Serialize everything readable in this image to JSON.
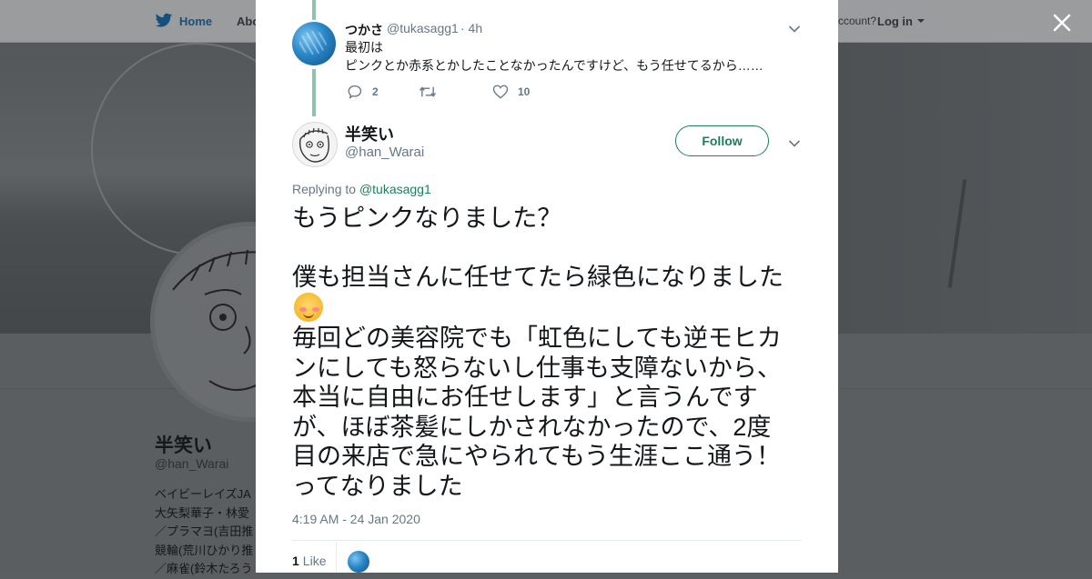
{
  "background": {
    "nav": {
      "home": "Home",
      "about": "Abo",
      "account_prompt": "ccount?",
      "login": "Log in"
    },
    "profile": {
      "name": "半笑い",
      "handle": "@han_Warai",
      "bio_lines": [
        "ベイビーレイズJA",
        "大矢梨華子・林愛",
        "／プラマヨ(吉田推",
        "競輪(荒川ひかり推",
        "／麻雀(鈴木たろう"
      ]
    }
  },
  "close_icon": "close-icon",
  "reply_tweet": {
    "name": "つかさ",
    "handle": "@tukasagg1",
    "time": "· 4h",
    "text_lines": [
      "最初は",
      "ピンクとか赤系とかしたことなかったんですけど、もう任せてるから……"
    ],
    "replies": "2",
    "retweets": "",
    "likes": "10"
  },
  "main_tweet": {
    "name": "半笑い",
    "handle": "@han_Warai",
    "follow_label": "Follow",
    "replying_prefix": "Replying to ",
    "replying_to": "@tukasagg1",
    "text_lines": [
      "もうピンクなりました？",
      "",
      "僕も担当さんに任せてたら緑色になりました",
      "",
      "毎回どの美容院でも「虹色にしても逆モヒカ",
      "ンにしても怒らないし仕事も支障ないから、",
      "本当に自由にお任せします」と言うんです",
      "が、ほぼ茶髪にしかされなかったので、2度",
      "目の来店で急にやられてもう生涯ここ通う！",
      "ってなりました"
    ],
    "emoji": "smiling-face-with-blush",
    "timestamp": "4:19 AM - 24 Jan 2020",
    "like_count": "1",
    "like_label": "Like"
  },
  "colors": {
    "accent": "#1a7f5a",
    "thread_line": "#8ec3b1",
    "muted": "#657786",
    "overlay_bg": "#5b5f62"
  }
}
